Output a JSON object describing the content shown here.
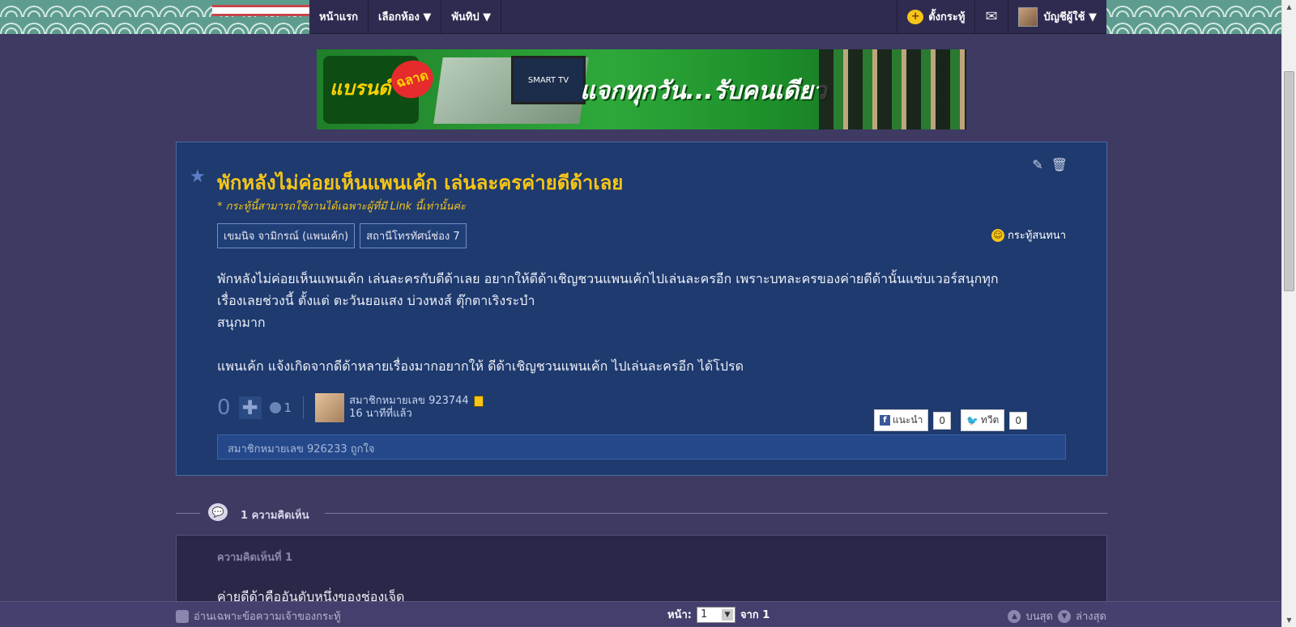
{
  "nav": {
    "home": "หน้าแรก",
    "rooms": "เลือกห้อง ▼",
    "pantip": "พันทิป ▼",
    "new_topic": "ตั้งกระทู้",
    "account": "บัญชีผู้ใช้ ▼"
  },
  "banner": {
    "brand": "แบรนด์",
    "bubble": "ฉลาด",
    "tv": "SMART TV",
    "text": "แจกทุกวัน...รับคนเดียว"
  },
  "post": {
    "title": "พักหลังไม่ค่อยเห็นแพนเค้ก เล่นละครค่ายดีด้าเลย",
    "note": "* กระทู้นี้สามารถใช้งานได้เฉพาะผู้ที่มี Link นี้เท่านั้นค่ะ",
    "tags": [
      "เขมนิจ จามิกรณ์ (แพนเค้ก)",
      "สถานีโทรทัศน์ช่อง 7"
    ],
    "type": "กระทู้สนทนา",
    "body": [
      "พักหลังไม่ค่อยเห็นแพนเค้ก เล่นละครกับดีด้าเลย อยากให้ดีด้าเชิญชวนแพนเค้กไปเล่นละครอีก เพราะบทละครของค่ายดีด้านั้นแซ่บเวอร์สนุกทุก",
      "เรื่องเลยช่วงนี้ ตั้งแต่ ตะวันยอแสง บ่วงหงส์ ตุ๊กตาเริงระบำ",
      "สนุกมาก",
      "",
      "แพนเค้ก แจ้งเกิดจากดีด้าหลายเรื่องมากอยากให้ ดีด้าเชิญชวนแพนเค้ก ไปเล่นละครอีก ได้โปรด"
    ],
    "vote_count": "0",
    "emotion_count": "1",
    "author": "สมาชิกหมายเลข 923744",
    "time": "16 นาทีที่แล้ว",
    "fb_label": "แนะนำ",
    "fb_count": "0",
    "tw_label": "ทวีต",
    "tw_count": "0",
    "liked_by": "สมาชิกหมายเลข 926233 ถูกใจ"
  },
  "comments": {
    "count_label": "1 ความคิดเห็น",
    "first_label": "ความคิดเห็นที่ 1",
    "first_text": "ค่ายดีด้าคืออันดับหนึ่งของช่องเจ็ด"
  },
  "bottombar": {
    "owner_only": "อ่านเฉพาะข้อความเจ้าของกระทู้",
    "page_label": "หน้า:",
    "page_value": "1",
    "of_label": "จาก 1",
    "top": "บนสุด",
    "bottom": "ล่างสุด"
  }
}
